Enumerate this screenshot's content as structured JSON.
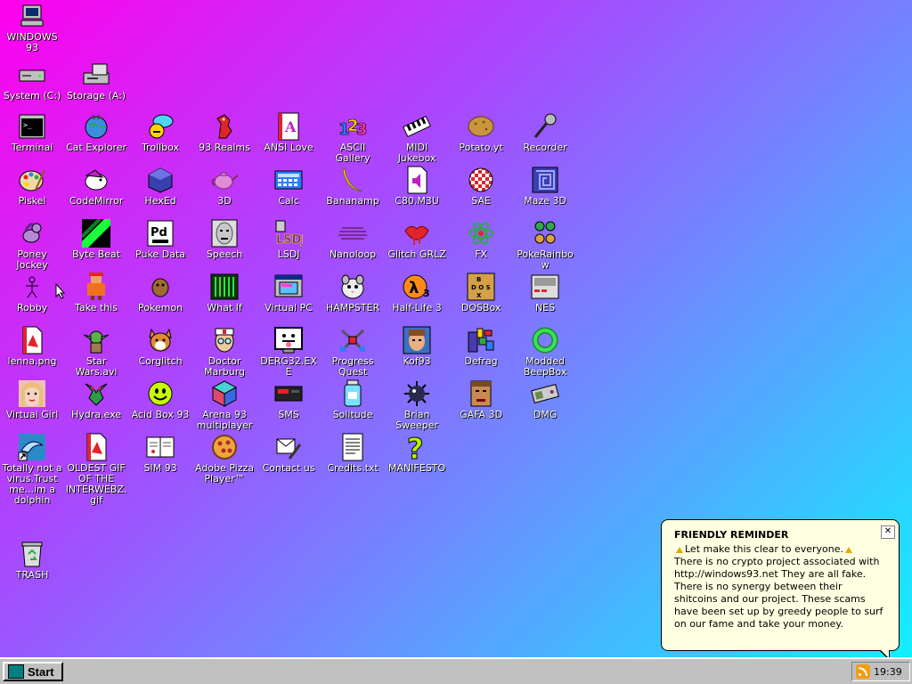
{
  "desktop_icons": [
    {
      "label": "WINDOWS 93",
      "icon": "computer-icon"
    },
    {
      "label": "System (C:)",
      "icon": "hard-drive-icon"
    },
    {
      "label": "Storage (A:)",
      "icon": "floppy-drive-icon"
    },
    {
      "label": "Terminal",
      "icon": "terminal-icon"
    },
    {
      "label": "Cat Explorer",
      "icon": "cat-globe-icon"
    },
    {
      "label": "Trollbox",
      "icon": "chat-bubble-icon"
    },
    {
      "label": "93 Realms",
      "icon": "dragon-icon"
    },
    {
      "label": "ANSI Love",
      "icon": "ansi-icon"
    },
    {
      "label": "ASCII Gallery",
      "icon": "numbers-icon"
    },
    {
      "label": "MIDI Jukebox",
      "icon": "piano-icon"
    },
    {
      "label": "Potato.yt",
      "icon": "potato-icon"
    },
    {
      "label": "Recorder",
      "icon": "microphone-icon"
    },
    {
      "label": "Piskel",
      "icon": "palette-icon"
    },
    {
      "label": "CodeMirror",
      "icon": "code-bird-icon"
    },
    {
      "label": "HexEd",
      "icon": "cube-icon"
    },
    {
      "label": "3D",
      "icon": "teapot-icon"
    },
    {
      "label": "Calc",
      "icon": "calculator-icon"
    },
    {
      "label": "Bananamp",
      "icon": "banana-icon"
    },
    {
      "label": "C80.M3U",
      "icon": "audio-file-icon"
    },
    {
      "label": "SAE",
      "icon": "checkered-ball-icon"
    },
    {
      "label": "Maze 3D",
      "icon": "maze-icon"
    },
    {
      "label": "Poney Jockey",
      "icon": "pony-icon"
    },
    {
      "label": "Byte Beat",
      "icon": "waveform-icon"
    },
    {
      "label": "Puke Data",
      "icon": "pd-icon"
    },
    {
      "label": "Speech",
      "icon": "face-icon"
    },
    {
      "label": "LSDJ",
      "icon": "lsdj-icon"
    },
    {
      "label": "Nanoloop",
      "icon": "wave-lines-icon"
    },
    {
      "label": "Glitch GRLZ",
      "icon": "lips-icon"
    },
    {
      "label": "FX",
      "icon": "atom-icon"
    },
    {
      "label": "PokeRainbow",
      "icon": "pokemon-trainers-icon"
    },
    {
      "label": "Robby",
      "icon": "stick-figure-icon"
    },
    {
      "label": "Take this",
      "icon": "pixel-character-icon"
    },
    {
      "label": "Pokemon",
      "icon": "pokemon-icon"
    },
    {
      "label": "What If",
      "icon": "green-grid-icon"
    },
    {
      "label": "Virtual PC",
      "icon": "virtual-pc-icon"
    },
    {
      "label": "HAMPSTER",
      "icon": "hamster-icon"
    },
    {
      "label": "Half-Life 3",
      "icon": "lambda-icon"
    },
    {
      "label": "DOSBox",
      "icon": "dosbox-icon"
    },
    {
      "label": "NES",
      "icon": "nes-icon"
    },
    {
      "label": "lenna.png",
      "icon": "image-file-icon"
    },
    {
      "label": "Star Wars.avi",
      "icon": "yoda-icon"
    },
    {
      "label": "Corglitch",
      "icon": "corgi-icon"
    },
    {
      "label": "Doctor Marburg",
      "icon": "doctor-icon"
    },
    {
      "label": "DERG32.EXE",
      "icon": "tongue-face-icon"
    },
    {
      "label": "Progress Quest",
      "icon": "crossed-swords-icon"
    },
    {
      "label": "Kof93",
      "icon": "fighter-icon"
    },
    {
      "label": "Defrag",
      "icon": "defrag-icon"
    },
    {
      "label": "Modded BeepBox",
      "icon": "green-ring-icon"
    },
    {
      "label": "Virtual Girl",
      "icon": "girl-face-icon"
    },
    {
      "label": "Hydra.exe",
      "icon": "hydra-icon"
    },
    {
      "label": "Acid Box 93",
      "icon": "smiley-icon"
    },
    {
      "label": "Arena 93 multiplayer",
      "icon": "color-cube-icon"
    },
    {
      "label": "SMS",
      "icon": "console-icon"
    },
    {
      "label": "Solitude",
      "icon": "jar-icon"
    },
    {
      "label": "Brian Sweeper",
      "icon": "mine-icon"
    },
    {
      "label": "GAFA 3D",
      "icon": "doom-face-icon"
    },
    {
      "label": "DMG",
      "icon": "gameboy-icon"
    },
    {
      "label": "Totally not a virus.Trust me...im a dolphin",
      "icon": "dolphin-icon"
    },
    {
      "label": "OLDEST GIF OF THE INTERWEBZ.gif",
      "icon": "gif-file-icon"
    },
    {
      "label": "SIM 93",
      "icon": "book-icon"
    },
    {
      "label": "Adobe Pizza Player™",
      "icon": "pizza-icon"
    },
    {
      "label": "Contact us",
      "icon": "contact-icon"
    },
    {
      "label": "Credits.txt",
      "icon": "text-file-icon"
    },
    {
      "label": "MANIFESTO",
      "icon": "question-mark-icon"
    },
    {
      "label": "TRASH",
      "icon": "recycle-bin-icon"
    }
  ],
  "balloon": {
    "title": "FRIENDLY REMINDER",
    "line1": "Let make this clear to everyone.",
    "body": "There is no crypto project associated with http://windows93.net They are all fake. There is no synergy between their shitcoins and our project. These scams have been set up by greedy people to surf on our fame and take your money.",
    "close": "✕"
  },
  "taskbar": {
    "start_label": "Start",
    "clock": "19:39"
  },
  "colors": {
    "gradient_start": "#ff00ee",
    "gradient_end": "#10f0ff",
    "taskbar": "#c0c0c0",
    "balloon_bg": "#ffffe1"
  }
}
